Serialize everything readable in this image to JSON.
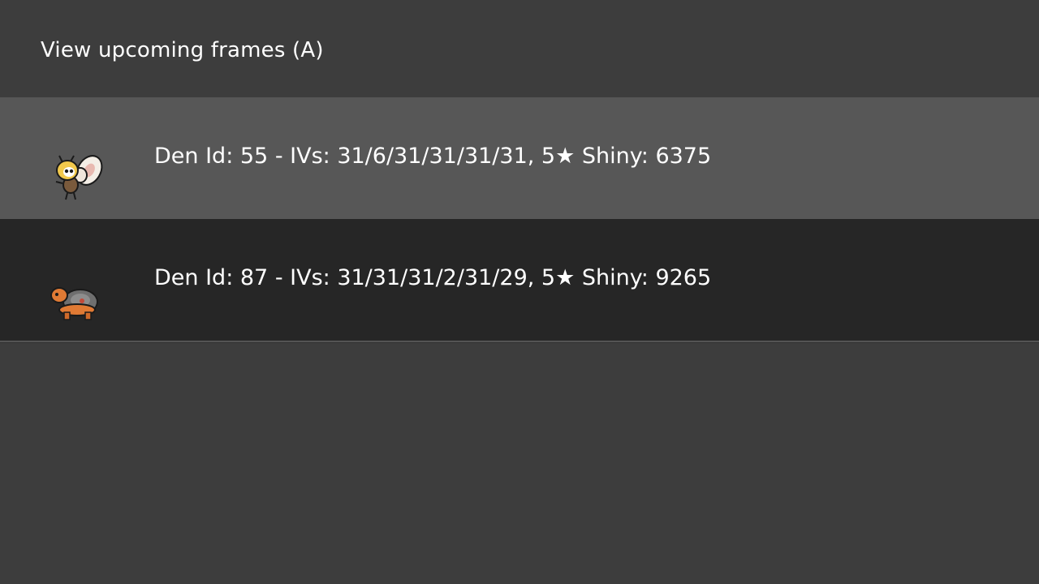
{
  "header": {
    "title": "View upcoming frames (A)"
  },
  "rows": [
    {
      "icon": "ribombee-icon",
      "text": "Den Id: 55 - IVs: 31/6/31/31/31/31, 5★ Shiny: 6375",
      "selected": true
    },
    {
      "icon": "torkoal-icon",
      "text": "Den Id: 87 - IVs: 31/31/31/2/31/29, 5★ Shiny: 9265",
      "selected": false
    }
  ],
  "colors": {
    "background": "#3d3d3d",
    "selected_row": "#575757",
    "row": "#262626",
    "text": "#ffffff"
  }
}
